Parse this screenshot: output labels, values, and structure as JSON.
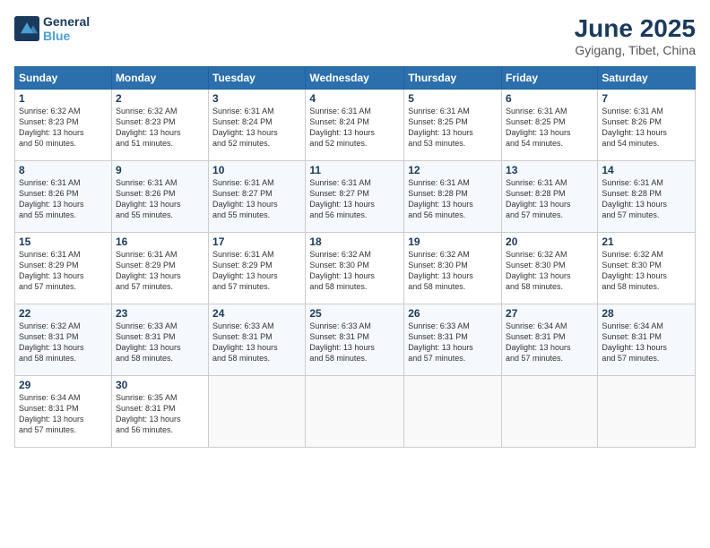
{
  "header": {
    "logo_line1": "General",
    "logo_line2": "Blue",
    "month": "June 2025",
    "location": "Gyigang, Tibet, China"
  },
  "days_of_week": [
    "Sunday",
    "Monday",
    "Tuesday",
    "Wednesday",
    "Thursday",
    "Friday",
    "Saturday"
  ],
  "weeks": [
    [
      {
        "day": "1",
        "info": "Sunrise: 6:32 AM\nSunset: 8:23 PM\nDaylight: 13 hours\nand 50 minutes."
      },
      {
        "day": "2",
        "info": "Sunrise: 6:32 AM\nSunset: 8:23 PM\nDaylight: 13 hours\nand 51 minutes."
      },
      {
        "day": "3",
        "info": "Sunrise: 6:31 AM\nSunset: 8:24 PM\nDaylight: 13 hours\nand 52 minutes."
      },
      {
        "day": "4",
        "info": "Sunrise: 6:31 AM\nSunset: 8:24 PM\nDaylight: 13 hours\nand 52 minutes."
      },
      {
        "day": "5",
        "info": "Sunrise: 6:31 AM\nSunset: 8:25 PM\nDaylight: 13 hours\nand 53 minutes."
      },
      {
        "day": "6",
        "info": "Sunrise: 6:31 AM\nSunset: 8:25 PM\nDaylight: 13 hours\nand 54 minutes."
      },
      {
        "day": "7",
        "info": "Sunrise: 6:31 AM\nSunset: 8:26 PM\nDaylight: 13 hours\nand 54 minutes."
      }
    ],
    [
      {
        "day": "8",
        "info": "Sunrise: 6:31 AM\nSunset: 8:26 PM\nDaylight: 13 hours\nand 55 minutes."
      },
      {
        "day": "9",
        "info": "Sunrise: 6:31 AM\nSunset: 8:26 PM\nDaylight: 13 hours\nand 55 minutes."
      },
      {
        "day": "10",
        "info": "Sunrise: 6:31 AM\nSunset: 8:27 PM\nDaylight: 13 hours\nand 55 minutes."
      },
      {
        "day": "11",
        "info": "Sunrise: 6:31 AM\nSunset: 8:27 PM\nDaylight: 13 hours\nand 56 minutes."
      },
      {
        "day": "12",
        "info": "Sunrise: 6:31 AM\nSunset: 8:28 PM\nDaylight: 13 hours\nand 56 minutes."
      },
      {
        "day": "13",
        "info": "Sunrise: 6:31 AM\nSunset: 8:28 PM\nDaylight: 13 hours\nand 57 minutes."
      },
      {
        "day": "14",
        "info": "Sunrise: 6:31 AM\nSunset: 8:28 PM\nDaylight: 13 hours\nand 57 minutes."
      }
    ],
    [
      {
        "day": "15",
        "info": "Sunrise: 6:31 AM\nSunset: 8:29 PM\nDaylight: 13 hours\nand 57 minutes."
      },
      {
        "day": "16",
        "info": "Sunrise: 6:31 AM\nSunset: 8:29 PM\nDaylight: 13 hours\nand 57 minutes."
      },
      {
        "day": "17",
        "info": "Sunrise: 6:31 AM\nSunset: 8:29 PM\nDaylight: 13 hours\nand 57 minutes."
      },
      {
        "day": "18",
        "info": "Sunrise: 6:32 AM\nSunset: 8:30 PM\nDaylight: 13 hours\nand 58 minutes."
      },
      {
        "day": "19",
        "info": "Sunrise: 6:32 AM\nSunset: 8:30 PM\nDaylight: 13 hours\nand 58 minutes."
      },
      {
        "day": "20",
        "info": "Sunrise: 6:32 AM\nSunset: 8:30 PM\nDaylight: 13 hours\nand 58 minutes."
      },
      {
        "day": "21",
        "info": "Sunrise: 6:32 AM\nSunset: 8:30 PM\nDaylight: 13 hours\nand 58 minutes."
      }
    ],
    [
      {
        "day": "22",
        "info": "Sunrise: 6:32 AM\nSunset: 8:31 PM\nDaylight: 13 hours\nand 58 minutes."
      },
      {
        "day": "23",
        "info": "Sunrise: 6:33 AM\nSunset: 8:31 PM\nDaylight: 13 hours\nand 58 minutes."
      },
      {
        "day": "24",
        "info": "Sunrise: 6:33 AM\nSunset: 8:31 PM\nDaylight: 13 hours\nand 58 minutes."
      },
      {
        "day": "25",
        "info": "Sunrise: 6:33 AM\nSunset: 8:31 PM\nDaylight: 13 hours\nand 58 minutes."
      },
      {
        "day": "26",
        "info": "Sunrise: 6:33 AM\nSunset: 8:31 PM\nDaylight: 13 hours\nand 57 minutes."
      },
      {
        "day": "27",
        "info": "Sunrise: 6:34 AM\nSunset: 8:31 PM\nDaylight: 13 hours\nand 57 minutes."
      },
      {
        "day": "28",
        "info": "Sunrise: 6:34 AM\nSunset: 8:31 PM\nDaylight: 13 hours\nand 57 minutes."
      }
    ],
    [
      {
        "day": "29",
        "info": "Sunrise: 6:34 AM\nSunset: 8:31 PM\nDaylight: 13 hours\nand 57 minutes."
      },
      {
        "day": "30",
        "info": "Sunrise: 6:35 AM\nSunset: 8:31 PM\nDaylight: 13 hours\nand 56 minutes."
      },
      null,
      null,
      null,
      null,
      null
    ]
  ]
}
